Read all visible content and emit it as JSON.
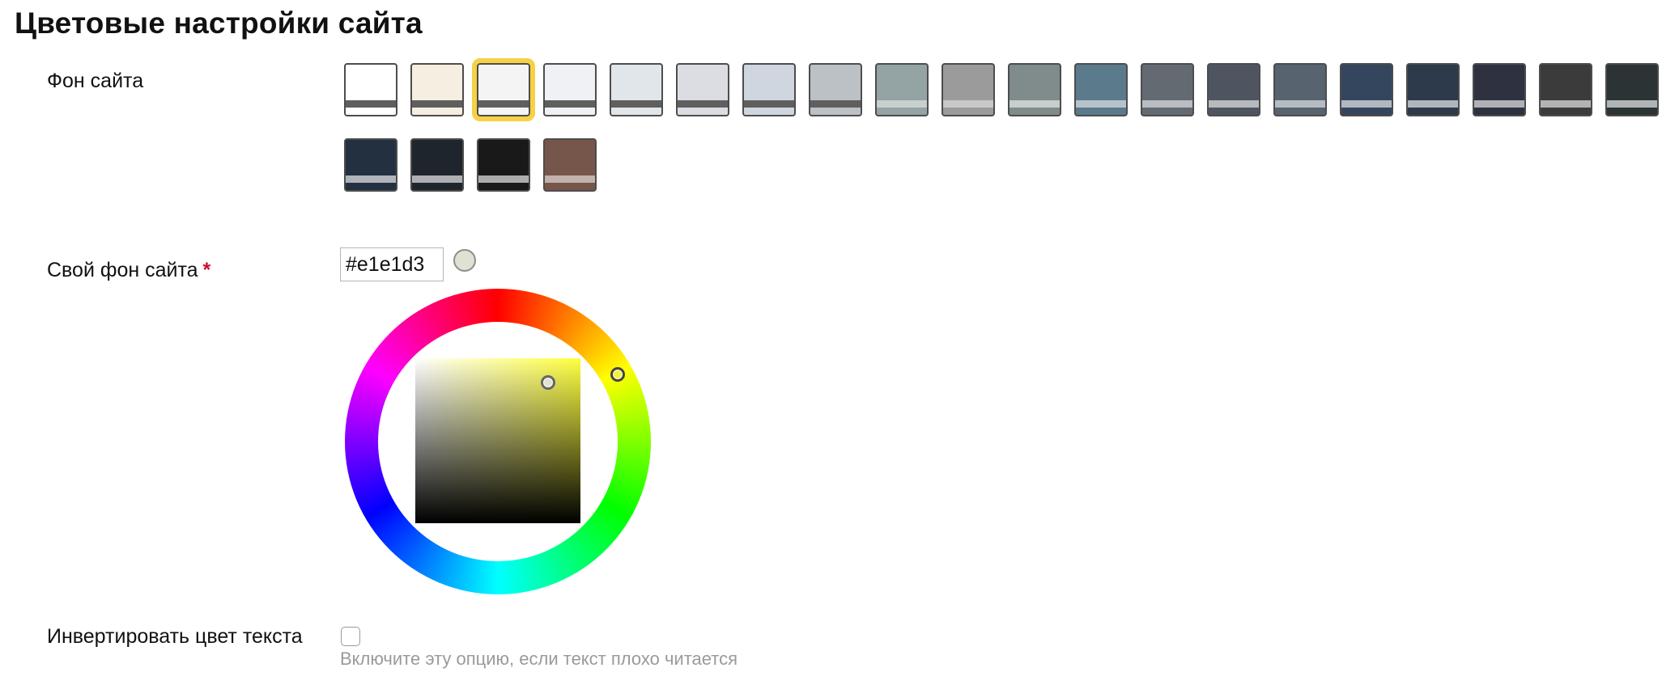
{
  "page_title": "Цветовые настройки сайта",
  "background_section": {
    "label": "Фон сайта",
    "selected_index": 2,
    "swatches": [
      {
        "bg": "#ffffff",
        "bar": "#5f5f5f"
      },
      {
        "bg": "#f6eee0",
        "bar": "#5f5f5f"
      },
      {
        "bg": "#f4f4f4",
        "bar": "#5f5f5f"
      },
      {
        "bg": "#eff1f4",
        "bar": "#5f5f5f"
      },
      {
        "bg": "#e1e6ea",
        "bar": "#5f5f5f"
      },
      {
        "bg": "#dcdde2",
        "bar": "#5f5f5f"
      },
      {
        "bg": "#cfd6df",
        "bar": "#5f5f5f"
      },
      {
        "bg": "#bcc1c5",
        "bar": "#5f5f5f"
      },
      {
        "bg": "#94a3a3",
        "bar": "#c9cfcf"
      },
      {
        "bg": "#9b9b9b",
        "bar": "#c8c8c8"
      },
      {
        "bg": "#808b8b",
        "bar": "#c8cdcd"
      },
      {
        "bg": "#5b7a8c",
        "bar": "#b6c3cb"
      },
      {
        "bg": "#636a72",
        "bar": "#b9bcc0"
      },
      {
        "bg": "#4f5560",
        "bar": "#b6b9bd"
      },
      {
        "bg": "#57636f",
        "bar": "#b6bcc1"
      },
      {
        "bg": "#33465d",
        "bar": "#b1b8c1"
      },
      {
        "bg": "#2c3a4b",
        "bar": "#b0b6bd"
      },
      {
        "bg": "#2d3140",
        "bar": "#afb1b6"
      },
      {
        "bg": "#3b3b3b",
        "bar": "#b3b3b3"
      },
      {
        "bg": "#2c3334",
        "bar": "#b1b4b4"
      },
      {
        "bg": "#233040",
        "bar": "#afb4ba"
      },
      {
        "bg": "#1f252c",
        "bar": "#adafb2"
      },
      {
        "bg": "#191919",
        "bar": "#acacac"
      },
      {
        "bg": "#76564a",
        "bar": "#c3b2ac"
      }
    ]
  },
  "custom_background": {
    "label": "Свой фон сайта",
    "required_mark": "*",
    "value": "#e1e1d3",
    "preview_color": "#e1e1d3"
  },
  "invert_text": {
    "label": "Инвертировать цвет текста",
    "checked": false,
    "hint": "Включите эту опцию, если текст плохо читается"
  }
}
